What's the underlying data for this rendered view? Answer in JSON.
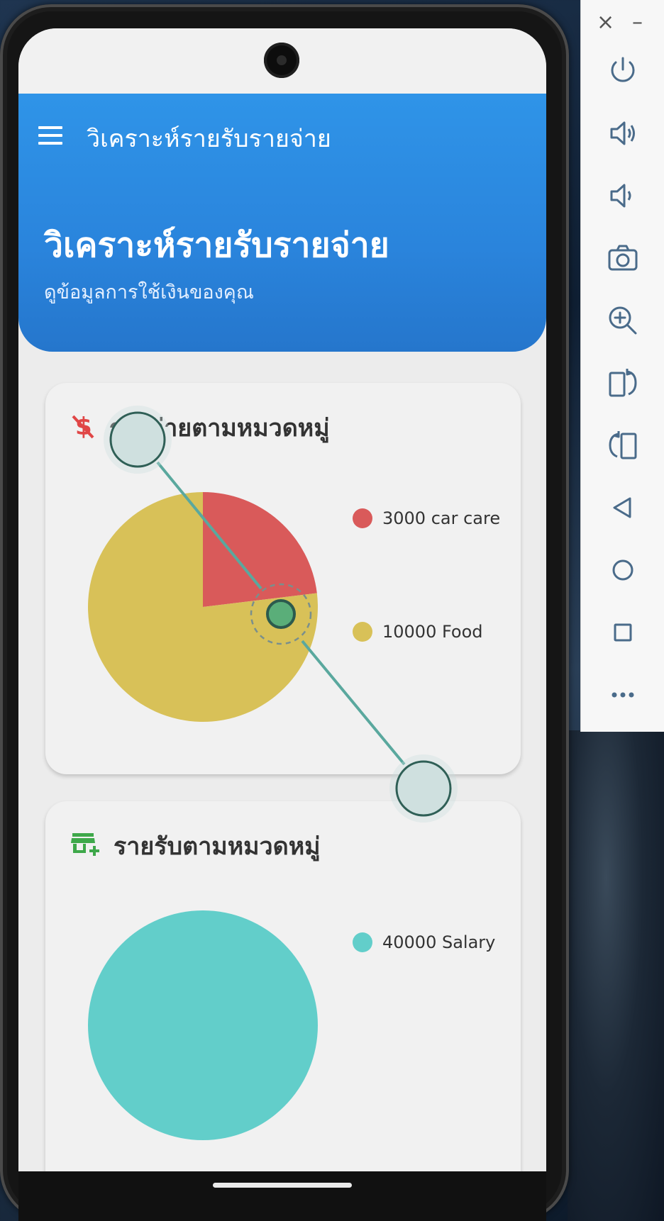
{
  "app": {
    "appbar_title": "วิเคราะห์รายรับรายจ่าย",
    "hero_title": "วิเคราะห์รายรับรายจ่าย",
    "hero_subtitle": "ดูข้อมูลการใช้เงินของคุณ"
  },
  "expense_card": {
    "title": "รายจ่ายตามหมวดหมู่",
    "icon": "money-off-icon",
    "legend": [
      {
        "label": "3000 car care",
        "color": "#d95a5a"
      },
      {
        "label": "10000 Food",
        "color": "#d8c158"
      }
    ]
  },
  "income_card": {
    "title": "รายรับตามหมวดหมู่",
    "icon": "store-add-icon",
    "legend": [
      {
        "label": "40000 Salary",
        "color": "#62ceca"
      }
    ]
  },
  "chart_data": [
    {
      "type": "pie",
      "categories": [
        "car care",
        "Food"
      ],
      "values": [
        3000,
        10000
      ],
      "colors": [
        "#d95a5a",
        "#d8c158"
      ],
      "title": "รายจ่ายตามหมวดหมู่",
      "legend": "right"
    },
    {
      "type": "pie",
      "categories": [
        "Salary"
      ],
      "values": [
        40000
      ],
      "colors": [
        "#62ceca"
      ],
      "title": "รายรับตามหมวดหมู่",
      "legend": "right"
    }
  ],
  "emulator_toolbar": {
    "buttons": [
      "close-icon",
      "minimize-icon",
      "power-icon",
      "volume-up-icon",
      "volume-down-icon",
      "camera-icon",
      "zoom-in-icon",
      "rotate-right-icon",
      "rotate-left-icon",
      "back-icon",
      "home-icon",
      "overview-icon",
      "more-icon"
    ],
    "close_glyph": "×",
    "minimize_glyph": "–"
  }
}
